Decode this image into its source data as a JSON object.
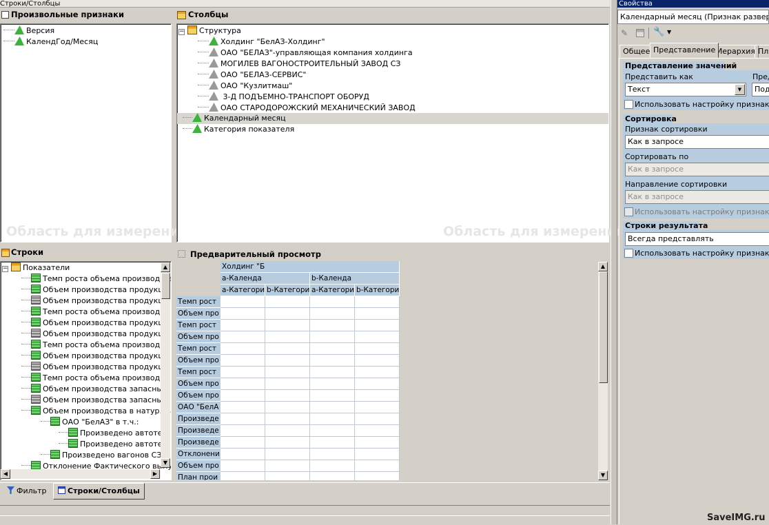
{
  "window_title": "Строки/Столбцы",
  "arbitrary": {
    "title": "Произвольные признаки",
    "items": [
      "Версия",
      "КалендГод/Месяц"
    ],
    "watermark": "Область для измерений"
  },
  "columns": {
    "title": "Столбцы",
    "root": "Структура",
    "children": [
      "Холдинг \"БелАЗ-Холдинг\"",
      "ОАО \"БЕЛАЗ\"-управляющая компания холдинга",
      "МОГИЛЕВ ВАГОНОСТРОИТЕЛЬНЫЙ ЗАВОД СЗ",
      "ОАО \"БЕЛАЗ-СЕРВИС\"",
      "ОАО \"Кузлитмаш\"",
      " 3-Д ПОДЪЕМНО-ТРАНСПОРТ ОБОРУД",
      "ОАО СТАРОДОРОЖСКИЙ МЕХАНИЧЕСКИЙ ЗАВОД"
    ],
    "siblings": [
      "Календарный месяц",
      "Категория показателя"
    ],
    "watermark": "Область для измерений"
  },
  "rows": {
    "title": "Строки",
    "root": "Показатели",
    "items": [
      {
        "label": "Темп роста объема производств",
        "icon": "fx"
      },
      {
        "label": "Объем производства продукци",
        "icon": "grid"
      },
      {
        "label": "Объем производства продукци",
        "icon": "gridg"
      },
      {
        "label": "Темп роста объема производст",
        "icon": "fx"
      },
      {
        "label": "Объем производства продукци",
        "icon": "grid"
      },
      {
        "label": "Объем производства продукци",
        "icon": "gridg"
      },
      {
        "label": "Темп роста объема производст",
        "icon": "fx"
      },
      {
        "label": "Объем производства продукци",
        "icon": "grid"
      },
      {
        "label": "Объем производства продукци",
        "icon": "gridg"
      },
      {
        "label": "Темп роста объема производст",
        "icon": "fx"
      },
      {
        "label": "Объем производства запасных",
        "icon": "grid"
      },
      {
        "label": "Объем производства запасных",
        "icon": "gridg"
      },
      {
        "label": "Объем производства в натур.вы",
        "icon": "fx"
      }
    ],
    "sub_parent": "ОАО \"БелАЗ\" в т.ч.:",
    "sub_items": [
      "Произведено автотех",
      "Произведено автотех"
    ],
    "after_items": [
      "Произведено вагонов СЗАІ",
      "Отклонение Фактического выпу"
    ]
  },
  "preview": {
    "title": "Предварительный просмотр",
    "header1": "Холдинг \"Б",
    "header2": [
      "a-Календа",
      "b-Календа"
    ],
    "header3": [
      "a-Категори",
      "b-Категори",
      "a-Категори",
      "b-Категори"
    ],
    "row_labels": [
      "Темп рост",
      "Объем про",
      "Темп рост",
      "Объем про",
      "Темп рост",
      "Объем про",
      "Темп рост",
      "Объем про",
      "Объем про",
      "ОАО \"БелА",
      "Произведе",
      "Произведе",
      "Произведе",
      "Отклонени",
      "Объем про",
      "План прои"
    ]
  },
  "bottom_tabs": [
    "Фильтр",
    "Строки/Столбцы"
  ],
  "properties": {
    "title": "Свойства",
    "selected": "Календарный месяц (Признак развертки)",
    "tabs": [
      "Общее",
      "Представление",
      "Иерархия",
      "Пл"
    ],
    "section_values": "Представление значений",
    "present_as_label": "Представить как",
    "present_as_value": "Текст",
    "present_label2": "Пред",
    "present_value2": "Под",
    "use_attr_setting": "Использовать настройку признака",
    "section_sort": "Сортировка",
    "sort_attr_label": "Признак сортировки",
    "sort_attr_value": "Как в запросе",
    "sort_by_label": "Сортировать по",
    "sort_by_value": "Как в запросе",
    "sort_dir_label": "Направление сортировки",
    "sort_dir_value": "Как в запросе",
    "section_result": "Строки результата",
    "result_value": "Всегда представлять"
  },
  "corner_watermark": "SaveIMG.ru"
}
